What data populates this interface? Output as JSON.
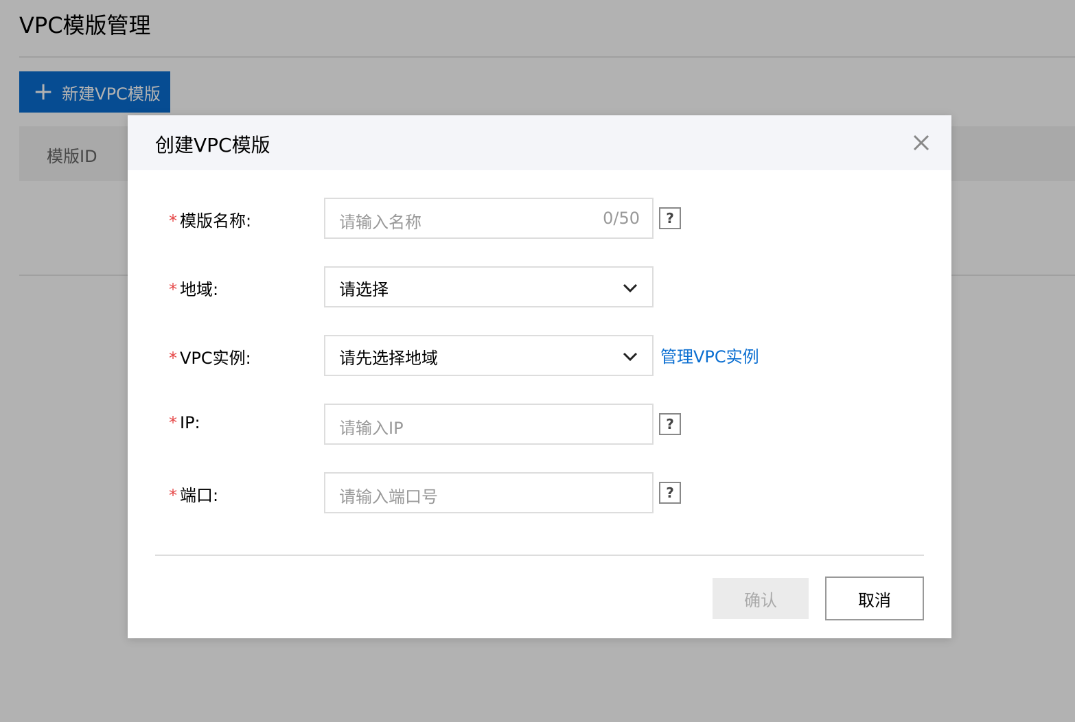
{
  "page": {
    "title": "VPC模版管理",
    "new_button_label": "新建VPC模版",
    "table_columns": [
      "模版ID"
    ]
  },
  "dialog": {
    "title": "创建VPC模版",
    "fields": {
      "name": {
        "label": "模版名称:",
        "placeholder": "请输入名称",
        "counter": "0/50"
      },
      "region": {
        "label": "地域:",
        "value": "请选择"
      },
      "vpc": {
        "label": "VPC实例:",
        "value": "请先选择地域",
        "link": "管理VPC实例"
      },
      "ip": {
        "label": "IP:",
        "placeholder": "请输入IP"
      },
      "port": {
        "label": "端口:",
        "placeholder": "请输入端口号"
      }
    },
    "required_mark": "*",
    "help_icon": "?",
    "confirm_label": "确认",
    "cancel_label": "取消"
  },
  "colors": {
    "accent": "#0a6ed1",
    "required": "#e54545"
  },
  "icons": [
    "plus-icon",
    "close-icon",
    "chevron-down-icon",
    "help-icon"
  ]
}
